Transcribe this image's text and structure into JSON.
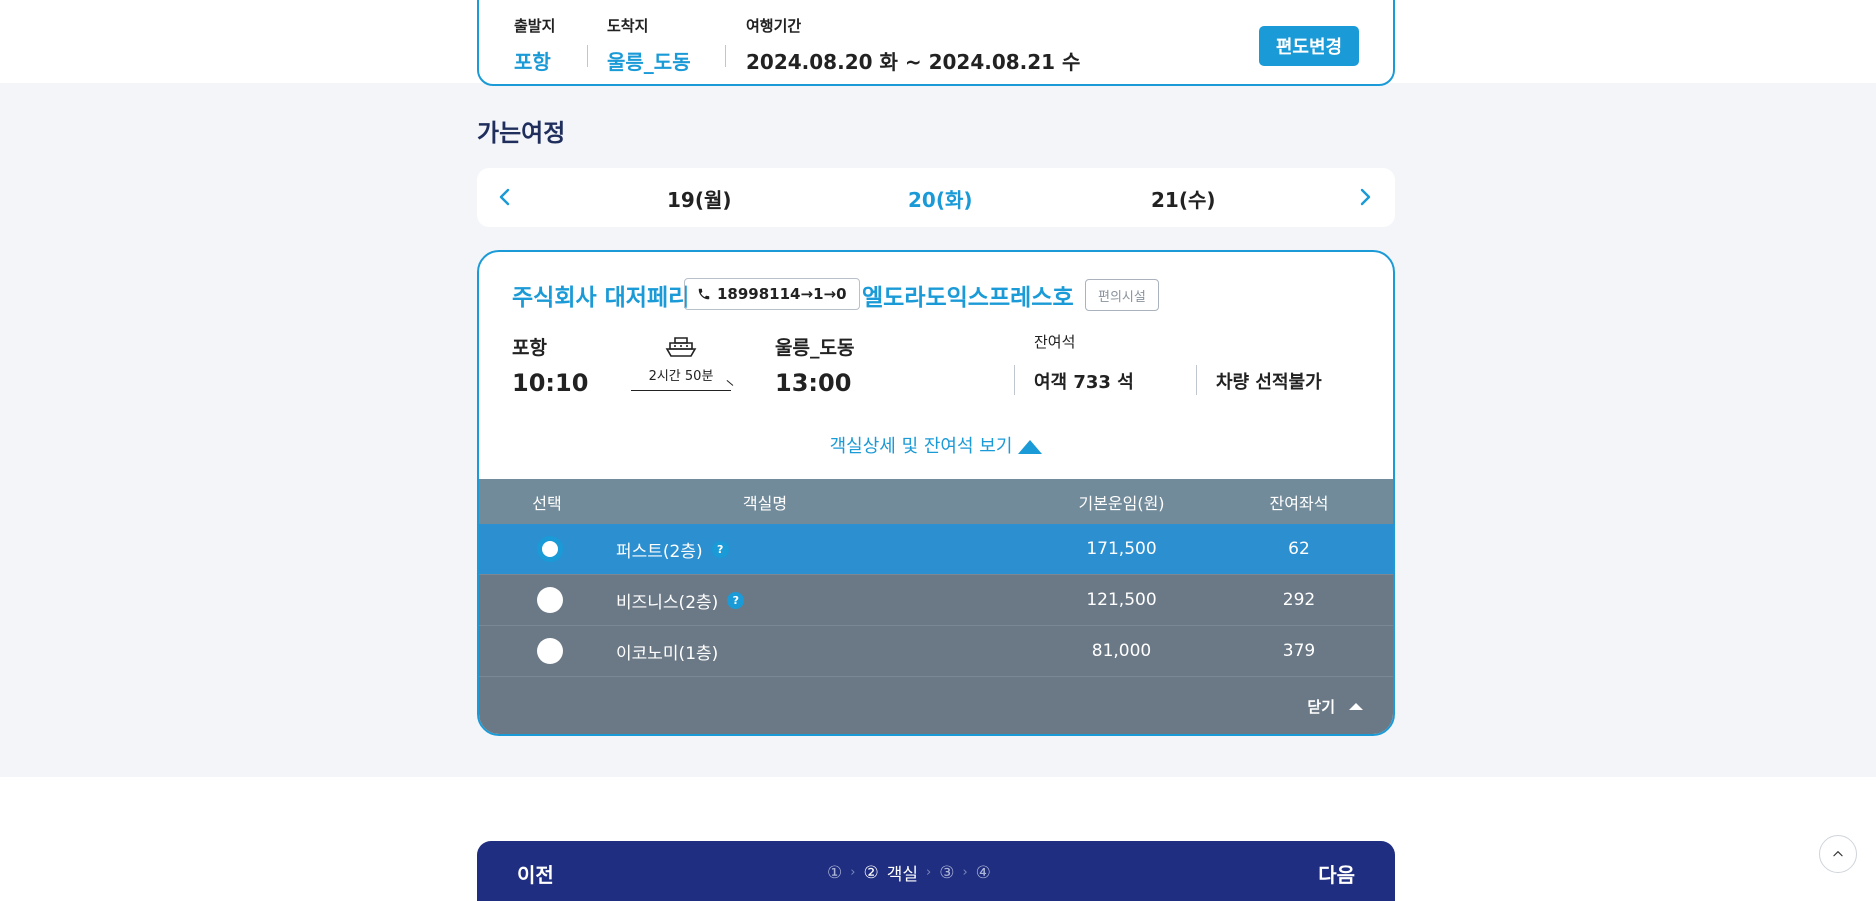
{
  "summary": {
    "departure_label": "출발지",
    "departure_value": "포항",
    "arrival_label": "도착지",
    "arrival_value": "울릉_도동",
    "period_label": "여행기간",
    "period_value": "2024.08.20 화 ~ 2024.08.21 수",
    "change_button": "편도변경"
  },
  "section_title": "가는여정",
  "date_nav": {
    "dates": [
      "19(월)",
      "20(화)",
      "21(수)"
    ],
    "active_index": 1
  },
  "ferry": {
    "company": "주식회사 대저페리",
    "phone": "18998114→1→0",
    "ship_name": "엘도라도익스프레스호",
    "facility_button": "편의시설",
    "from_port": "울릉_도동",
    "depart_port": "포항",
    "depart_time": "10:10",
    "arrive_port": "울릉_도동",
    "arrive_time": "13:00",
    "duration": "2시간 50분",
    "remaining_label": "잔여석",
    "passenger_seats": "여객 733 석",
    "vehicle_seats": "차량 선적불가",
    "detail_toggle": "객실상세 및 잔여석 보기"
  },
  "cabin_table": {
    "headers": [
      "선택",
      "객실명",
      "기본운임(원)",
      "잔여좌석"
    ],
    "rows": [
      {
        "name": "퍼스트(2층)",
        "fare": "171,500",
        "seats": "62",
        "help": "?",
        "selected": true
      },
      {
        "name": "비즈니스(2층)",
        "fare": "121,500",
        "seats": "292",
        "help": "?",
        "selected": false
      },
      {
        "name": "이코노미(1층)",
        "fare": "81,000",
        "seats": "379",
        "help": "",
        "selected": false
      }
    ],
    "close_label": "닫기"
  },
  "stepbar": {
    "prev": "이전",
    "next": "다음",
    "step1": "①",
    "step2": "②",
    "step2_label": "객실",
    "step3": "③",
    "step4": "④",
    "separator": "›"
  },
  "colors": {
    "accent": "#1a9ad6",
    "navy": "#1f2e80",
    "table_header": "#728b9b",
    "table_row": "#6b7886",
    "table_selected": "#2b8fd0"
  },
  "icons": [
    "phone-icon",
    "ship-icon",
    "chevron-left-icon",
    "chevron-right-icon",
    "triangle-up-icon",
    "scroll-top-icon"
  ]
}
